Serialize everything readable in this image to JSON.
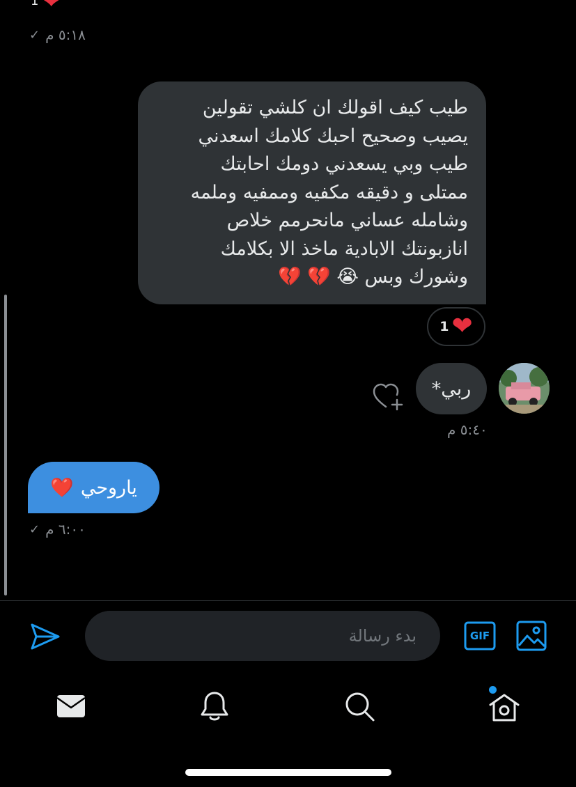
{
  "conversation": {
    "top_reaction": {
      "count": "1"
    },
    "top_meta": {
      "time": "٥:١٨ م"
    },
    "incoming_long": {
      "lines": [
        "طيب كيف اقولك ان كلشي تقولين",
        "يصيب وصحيح احبك كلامك اسعدني",
        "طيب وبي يسعدني دومك احابتك",
        "ممتلى و دقيقه مكفيه وممفيه وملمه",
        "وشامله عساني مانحرمم خلاص",
        "انازبونتك الابادية ماخذ الا بكلامك",
        "وشورك وبس 😭 💔 💔"
      ]
    },
    "long_reaction": {
      "count": "1",
      "emoji": "❤"
    },
    "incoming_short": {
      "text": "ربي*",
      "time": "٥:٤٠ م"
    },
    "outgoing": {
      "text": "ياروحي",
      "emoji": "❤️",
      "time": "٦:٠٠ م"
    }
  },
  "composer": {
    "placeholder": "بدء رسالة",
    "gif_label": "GIF"
  },
  "colors": {
    "accent": "#1d9bf0",
    "bubble_out": "#3d8fe0",
    "bubble_in": "#2f3336",
    "heart": "#e8303f"
  },
  "icons": [
    "send-icon",
    "gif-icon",
    "image-icon",
    "mail-icon",
    "bell-icon",
    "search-icon",
    "home-icon",
    "heart-plus-icon"
  ]
}
